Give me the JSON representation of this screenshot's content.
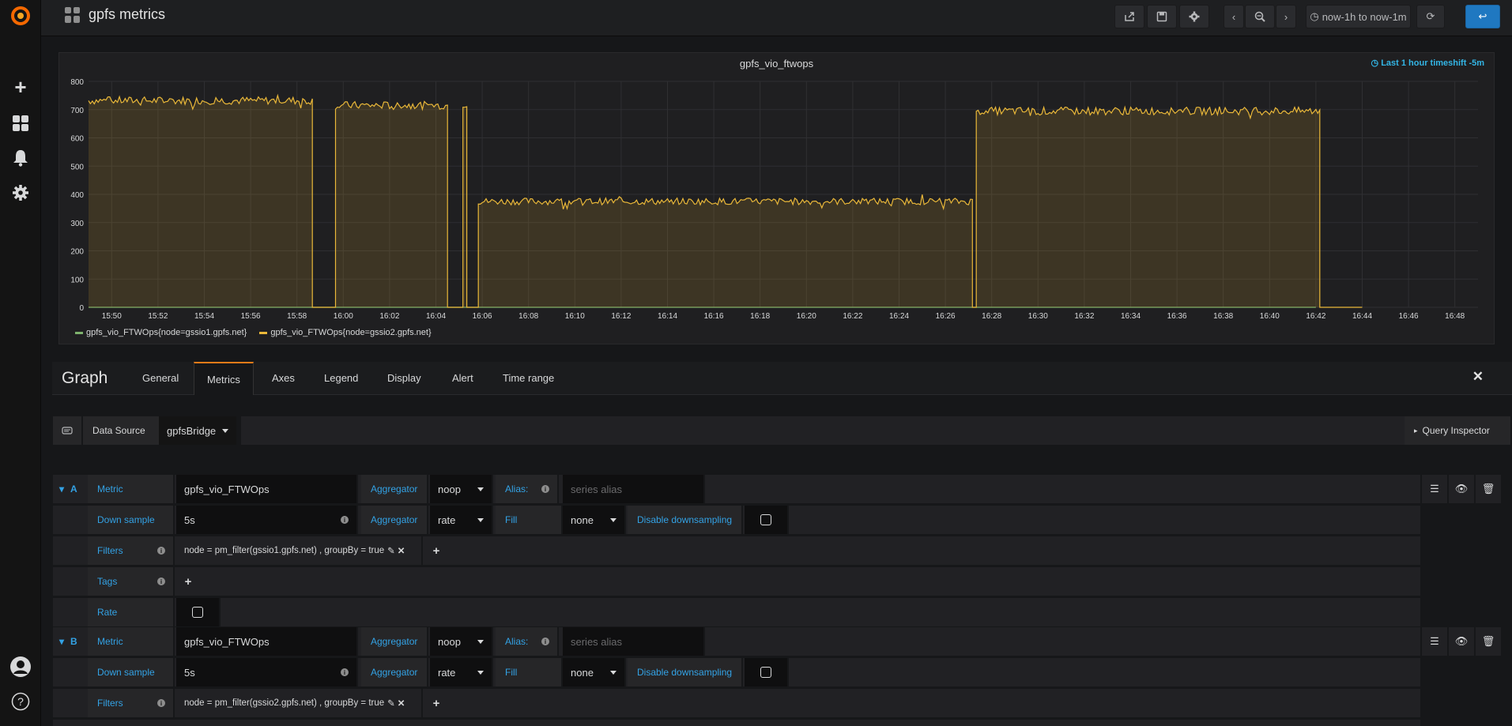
{
  "navbar": {
    "title": "gpfs metrics",
    "time_range": "now-1h to now-1m"
  },
  "panel": {
    "title": "gpfs_vio_ftwops",
    "timeshift": "Last 1 hour timeshift -5m"
  },
  "chart_data": {
    "type": "area",
    "title": "gpfs_vio_ftwops",
    "xlabel": "",
    "ylabel": "",
    "x_ticks": [
      "15:50",
      "15:52",
      "15:54",
      "15:56",
      "15:58",
      "16:00",
      "16:02",
      "16:04",
      "16:06",
      "16:08",
      "16:10",
      "16:12",
      "16:14",
      "16:16",
      "16:18",
      "16:20",
      "16:22",
      "16:24",
      "16:26",
      "16:28",
      "16:30",
      "16:32",
      "16:34",
      "16:36",
      "16:38",
      "16:40",
      "16:42",
      "16:44",
      "16:46",
      "16:48"
    ],
    "y_ticks": [
      0,
      100,
      200,
      300,
      400,
      500,
      600,
      700,
      800
    ],
    "ylim": [
      0,
      800
    ],
    "xlim": [
      "15:49",
      "16:49"
    ],
    "grid": true,
    "legend_position": "bottom-left",
    "series": [
      {
        "name": "gpfs_vio_FTWOps{node=gssio1.gpfs.net}",
        "color": "#7eb26d",
        "segments": [
          {
            "start": "15:49",
            "end": "16:42",
            "value": 0
          }
        ]
      },
      {
        "name": "gpfs_vio_FTWOps{node=gssio2.gpfs.net}",
        "color": "#eab839",
        "segments": [
          {
            "start": "15:49",
            "end": "15:58:40",
            "value": 732
          },
          {
            "start": "15:58:40",
            "end": "15:59:40",
            "value": 0
          },
          {
            "start": "15:59:40",
            "end": "16:04:30",
            "value": 715
          },
          {
            "start": "16:04:30",
            "end": "16:05:10",
            "value": 0
          },
          {
            "start": "16:05:10",
            "end": "16:05:20",
            "value": 720
          },
          {
            "start": "16:05:20",
            "end": "16:05:50",
            "value": 0
          },
          {
            "start": "16:05:50",
            "end": "16:27:10",
            "value": 375
          },
          {
            "start": "16:27:10",
            "end": "16:27:20",
            "value": 0
          },
          {
            "start": "16:27:20",
            "end": "16:42:10",
            "value": 695
          },
          {
            "start": "16:42:10",
            "end": "16:44",
            "value": 0
          }
        ]
      }
    ]
  },
  "editor": {
    "title": "Graph",
    "tabs": [
      "General",
      "Metrics",
      "Axes",
      "Legend",
      "Display",
      "Alert",
      "Time range"
    ],
    "active_tab": "Metrics",
    "datasource_label": "Data Source",
    "datasource_value": "gpfsBridge",
    "query_inspector": "Query Inspector"
  },
  "queries": [
    {
      "ref": "A",
      "metric_label": "Metric",
      "metric": "gpfs_vio_FTWOps",
      "aggregator_label": "Aggregator",
      "aggregator": "noop",
      "alias_label": "Alias:",
      "alias_placeholder": "series alias",
      "downsample_label": "Down sample",
      "downsample": "5s",
      "ds_aggregator_label": "Aggregator",
      "ds_aggregator": "rate",
      "fill_label": "Fill",
      "fill": "none",
      "disable_label": "Disable downsampling",
      "filters_label": "Filters",
      "filter": "node = pm_filter(gssio1.gpfs.net) , groupBy = true",
      "tags_label": "Tags",
      "rate_label": "Rate"
    },
    {
      "ref": "B",
      "metric_label": "Metric",
      "metric": "gpfs_vio_FTWOps",
      "aggregator_label": "Aggregator",
      "aggregator": "noop",
      "alias_label": "Alias:",
      "alias_placeholder": "series alias",
      "downsample_label": "Down sample",
      "downsample": "5s",
      "ds_aggregator_label": "Aggregator",
      "ds_aggregator": "rate",
      "fill_label": "Fill",
      "fill": "none",
      "disable_label": "Disable downsampling",
      "filters_label": "Filters",
      "filter": "node = pm_filter(gssio2.gpfs.net) , groupBy = true"
    }
  ]
}
